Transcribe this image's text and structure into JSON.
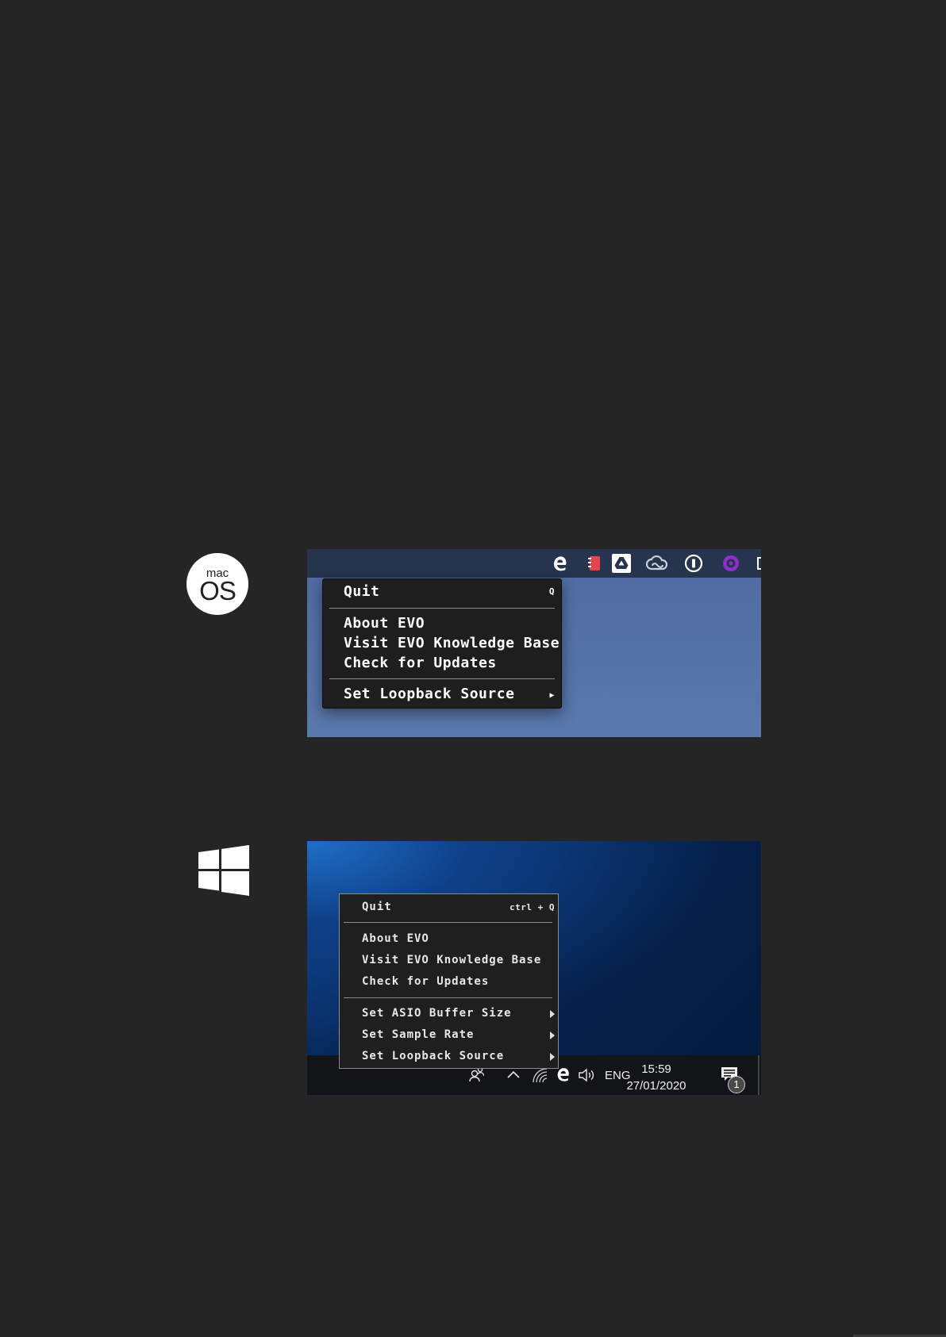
{
  "mac": {
    "logo_small": "mac",
    "logo_big": "OS",
    "menu": {
      "quit": "Quit",
      "quit_shortcut": "Q",
      "about": "About EVO",
      "visit": "Visit EVO Knowledge Base",
      "check": "Check for Updates",
      "loopback": "Set Loopback Source",
      "submenu_arrow": "▶"
    }
  },
  "win": {
    "menu": {
      "quit": "Quit",
      "quit_shortcut": "ctrl + Q",
      "about": "About EVO",
      "visit": "Visit EVO Knowledge Base",
      "check": "Check for Updates",
      "asio": "Set ASIO Buffer Size",
      "sample_rate": "Set Sample Rate",
      "loopback": "Set Loopback Source"
    },
    "taskbar": {
      "language": "ENG",
      "time": "15:59",
      "date": "27/01/2020",
      "notification_count": "1"
    }
  },
  "colors": {
    "background": "#252525",
    "mac_menubar": "#26344e",
    "mac_desktop": "#5573a9",
    "menu_bg": "#1e1e1e",
    "loopback_accent": "#8b2fc9"
  }
}
